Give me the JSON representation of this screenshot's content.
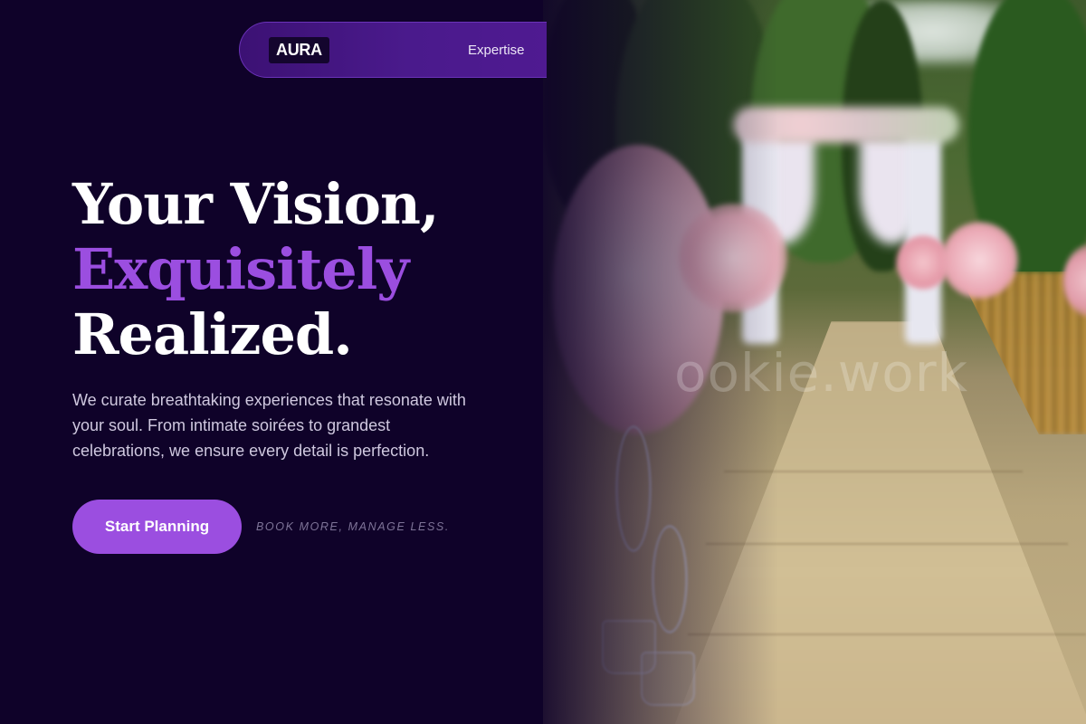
{
  "nav": {
    "logo": "AURA",
    "links": [
      "Expertise"
    ]
  },
  "hero": {
    "headline_line1": "Your Vision,",
    "headline_line2": "Exquisitely",
    "headline_line3": "Realized.",
    "description": "We curate breathtaking experiences that resonate with your soul. From intimate soirées to grandest celebrations, we ensure every detail is perfection.",
    "cta_label": "Start Planning",
    "tagline": "BOOK MORE, MANAGE LESS."
  },
  "image": {
    "subject": "wedding-aisle-photo",
    "watermark": "ookie.work"
  },
  "colors": {
    "background": "#0f0229",
    "accent": "#9b4ee0",
    "nav_bg": "#4a1a8c",
    "text": "#ffffff",
    "muted": "#cfc8df"
  }
}
